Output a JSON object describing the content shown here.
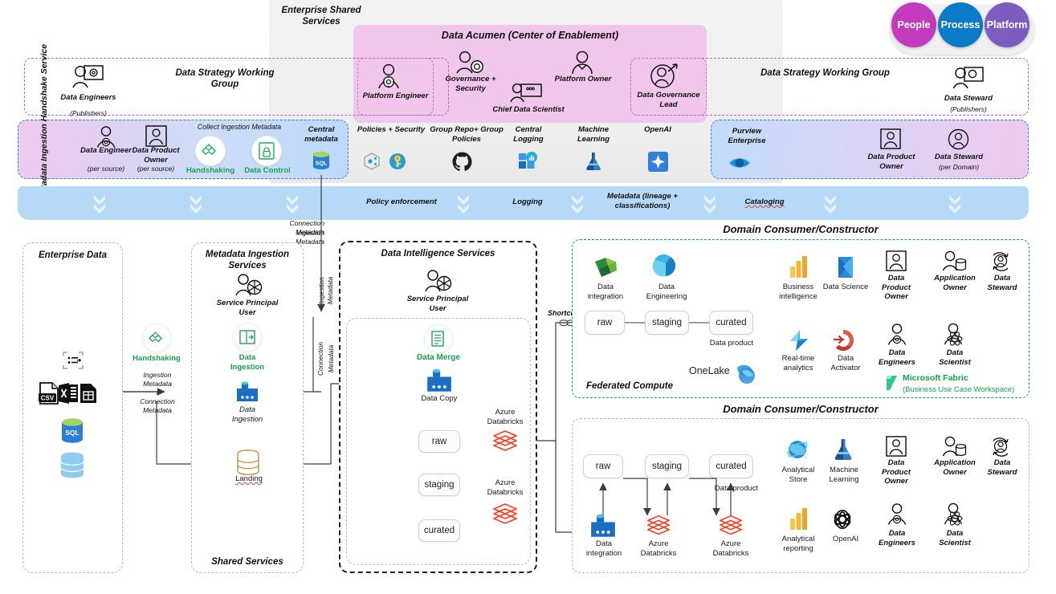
{
  "top": {
    "enterprise_shared_services": "Enterprise Shared Services",
    "acumen_title": "Data Acumen (Center of Enablement)",
    "dswg_left": "Data Strategy Working Group",
    "dswg_right": "Data Strategy Working Group",
    "pillars": [
      {
        "label": "People",
        "color": "#c23bbd"
      },
      {
        "label": "Process",
        "color": "#0b7bc8"
      },
      {
        "label": "Platform",
        "color": "#7d5cc0"
      }
    ],
    "dswg_left_role": {
      "title": "Data Engineers",
      "sub": "(Publishers)"
    },
    "dswg_right_role": {
      "title": "Data Steward",
      "sub": "(Publishers)"
    },
    "acumen_roles": [
      {
        "label": "Platform Engineer"
      },
      {
        "label": "Governance + Security"
      },
      {
        "label": "Chief Data Scientist"
      },
      {
        "label": "Platform Owner"
      },
      {
        "label": "Data Governance Lead"
      }
    ]
  },
  "handshake_band": {
    "side_label": "Metadata Ingestion Handshake Service",
    "collect_label": "Collect Ingestion Metadata",
    "central_metadata": "Central metadata",
    "roles": [
      {
        "title": "Data Engineer",
        "sub": "(per source)"
      },
      {
        "title": "Data Product Owner",
        "sub": "(per source)"
      }
    ],
    "services": [
      {
        "label": "Handshaking"
      },
      {
        "label": "Data Control"
      }
    ],
    "db_label": "SQL"
  },
  "shared_services": {
    "items": [
      {
        "label": "Policies + Security",
        "icon": "policy-key-icon"
      },
      {
        "label": "Group Repo+ Group Policies",
        "icon": "github-icon"
      },
      {
        "label": "Central Logging",
        "icon": "log-analytics-icon"
      },
      {
        "label": "Machine Learning",
        "icon": "ml-flask-icon"
      },
      {
        "label": "OpenAI",
        "icon": "openai-sparkle-icon"
      }
    ]
  },
  "purview_band": {
    "title": "Purview Enterprise",
    "roles": [
      {
        "title": "Data Product Owner",
        "sub": ""
      },
      {
        "title": "Data Steward",
        "sub": "(per Domain)"
      }
    ]
  },
  "blue_band": {
    "labels": [
      "Policy enforcement",
      "Logging",
      "Metadata (lineage + classifications)",
      "Cataloging"
    ]
  },
  "connectors": {
    "connection_metadata": "Connection Metadata",
    "ingestion_metadata": "Ingestion Metadata",
    "ingestion": "Ingestion",
    "connection": "Connection",
    "metadata": "Metadata",
    "shortcut": "Shortcut"
  },
  "enterprise_data": {
    "title": "Enterprise Data",
    "icons": [
      "dataset-icon",
      "csv-icon",
      "excel-icon",
      "table-icon",
      "sql-db-icon",
      "generic-db-icon"
    ]
  },
  "metadata_ingestion": {
    "title": "Metadata Ingestion Services",
    "service_principal": "Service Principal User",
    "handshaking": "Handshaking",
    "middle_label": "Ingestion Metadata / Connection Metadata",
    "middle_lines": [
      "Ingestion",
      "Metadata",
      "/",
      "Connection",
      "Metadata"
    ],
    "data_ingestion_green": "Data Ingestion",
    "data_ingestion": "Data Ingestion",
    "landing": "Landing",
    "footer": "Shared Services"
  },
  "data_intelligence": {
    "title": "Data Intelligence Services",
    "service_principal": "Service Principal User",
    "data_merge": "Data Merge",
    "data_copy": "Data Copy",
    "stages": [
      "raw",
      "staging",
      "curated"
    ],
    "databricks_label": "Azure Databricks"
  },
  "domain1": {
    "title": "Domain Consumer/Constructor",
    "federated_compute": "Federated Compute",
    "onelake": "OneLake",
    "fabric_title": "Microsoft Fabric",
    "fabric_sub": "(Business Use Case Workspace)",
    "top_tools": [
      {
        "label": "Data integration",
        "icon": "data-factory-green-icon"
      },
      {
        "label": "Data Engineering",
        "icon": "fabric-data-engineering-icon"
      }
    ],
    "stages": [
      "raw",
      "staging",
      "curated"
    ],
    "data_product": "Data product",
    "right_tools": [
      {
        "label": "Business intelligence",
        "icon": "power-bi-icon"
      },
      {
        "label": "Data Science",
        "icon": "data-science-icon"
      },
      {
        "label": "Real-time analytics",
        "icon": "realtime-analytics-icon"
      },
      {
        "label": "Data Activator",
        "icon": "data-activator-icon"
      }
    ],
    "roles": [
      {
        "label": "Data Product Owner",
        "icon": "data-product-owner-icon"
      },
      {
        "label": "Application Owner",
        "icon": "application-owner-icon"
      },
      {
        "label": "Data Steward",
        "icon": "data-steward-icon"
      },
      {
        "label": "Data Engineers",
        "icon": "data-engineers-icon"
      },
      {
        "label": "Data Scientist",
        "icon": "data-scientist-icon"
      }
    ]
  },
  "domain2": {
    "title": "Domain Consumer/Constructor",
    "stages": [
      "raw",
      "staging",
      "curated"
    ],
    "data_product": "Data product",
    "bottom_tools": [
      {
        "label": "Data integration",
        "icon": "data-factory-icon"
      },
      {
        "label": "Azure Databricks",
        "icon": "databricks-icon"
      },
      {
        "label": "Azure Databricks",
        "icon": "databricks-icon"
      }
    ],
    "right_tools": [
      {
        "label": "Analytical Store",
        "icon": "cosmos-db-icon"
      },
      {
        "label": "Machine Learning",
        "icon": "ml-flask-icon"
      },
      {
        "label": "Analytical reporting",
        "icon": "power-bi-icon"
      },
      {
        "label": "OpenAI",
        "icon": "openai-logo-icon"
      }
    ],
    "roles": [
      {
        "label": "Data Product Owner",
        "icon": "data-product-owner-icon"
      },
      {
        "label": "Application Owner",
        "icon": "application-owner-icon"
      },
      {
        "label": "Data Steward",
        "icon": "data-steward-icon"
      },
      {
        "label": "Data Engineers",
        "icon": "data-engineers-icon"
      },
      {
        "label": "Data Scientist",
        "icon": "data-scientist-icon"
      }
    ]
  }
}
